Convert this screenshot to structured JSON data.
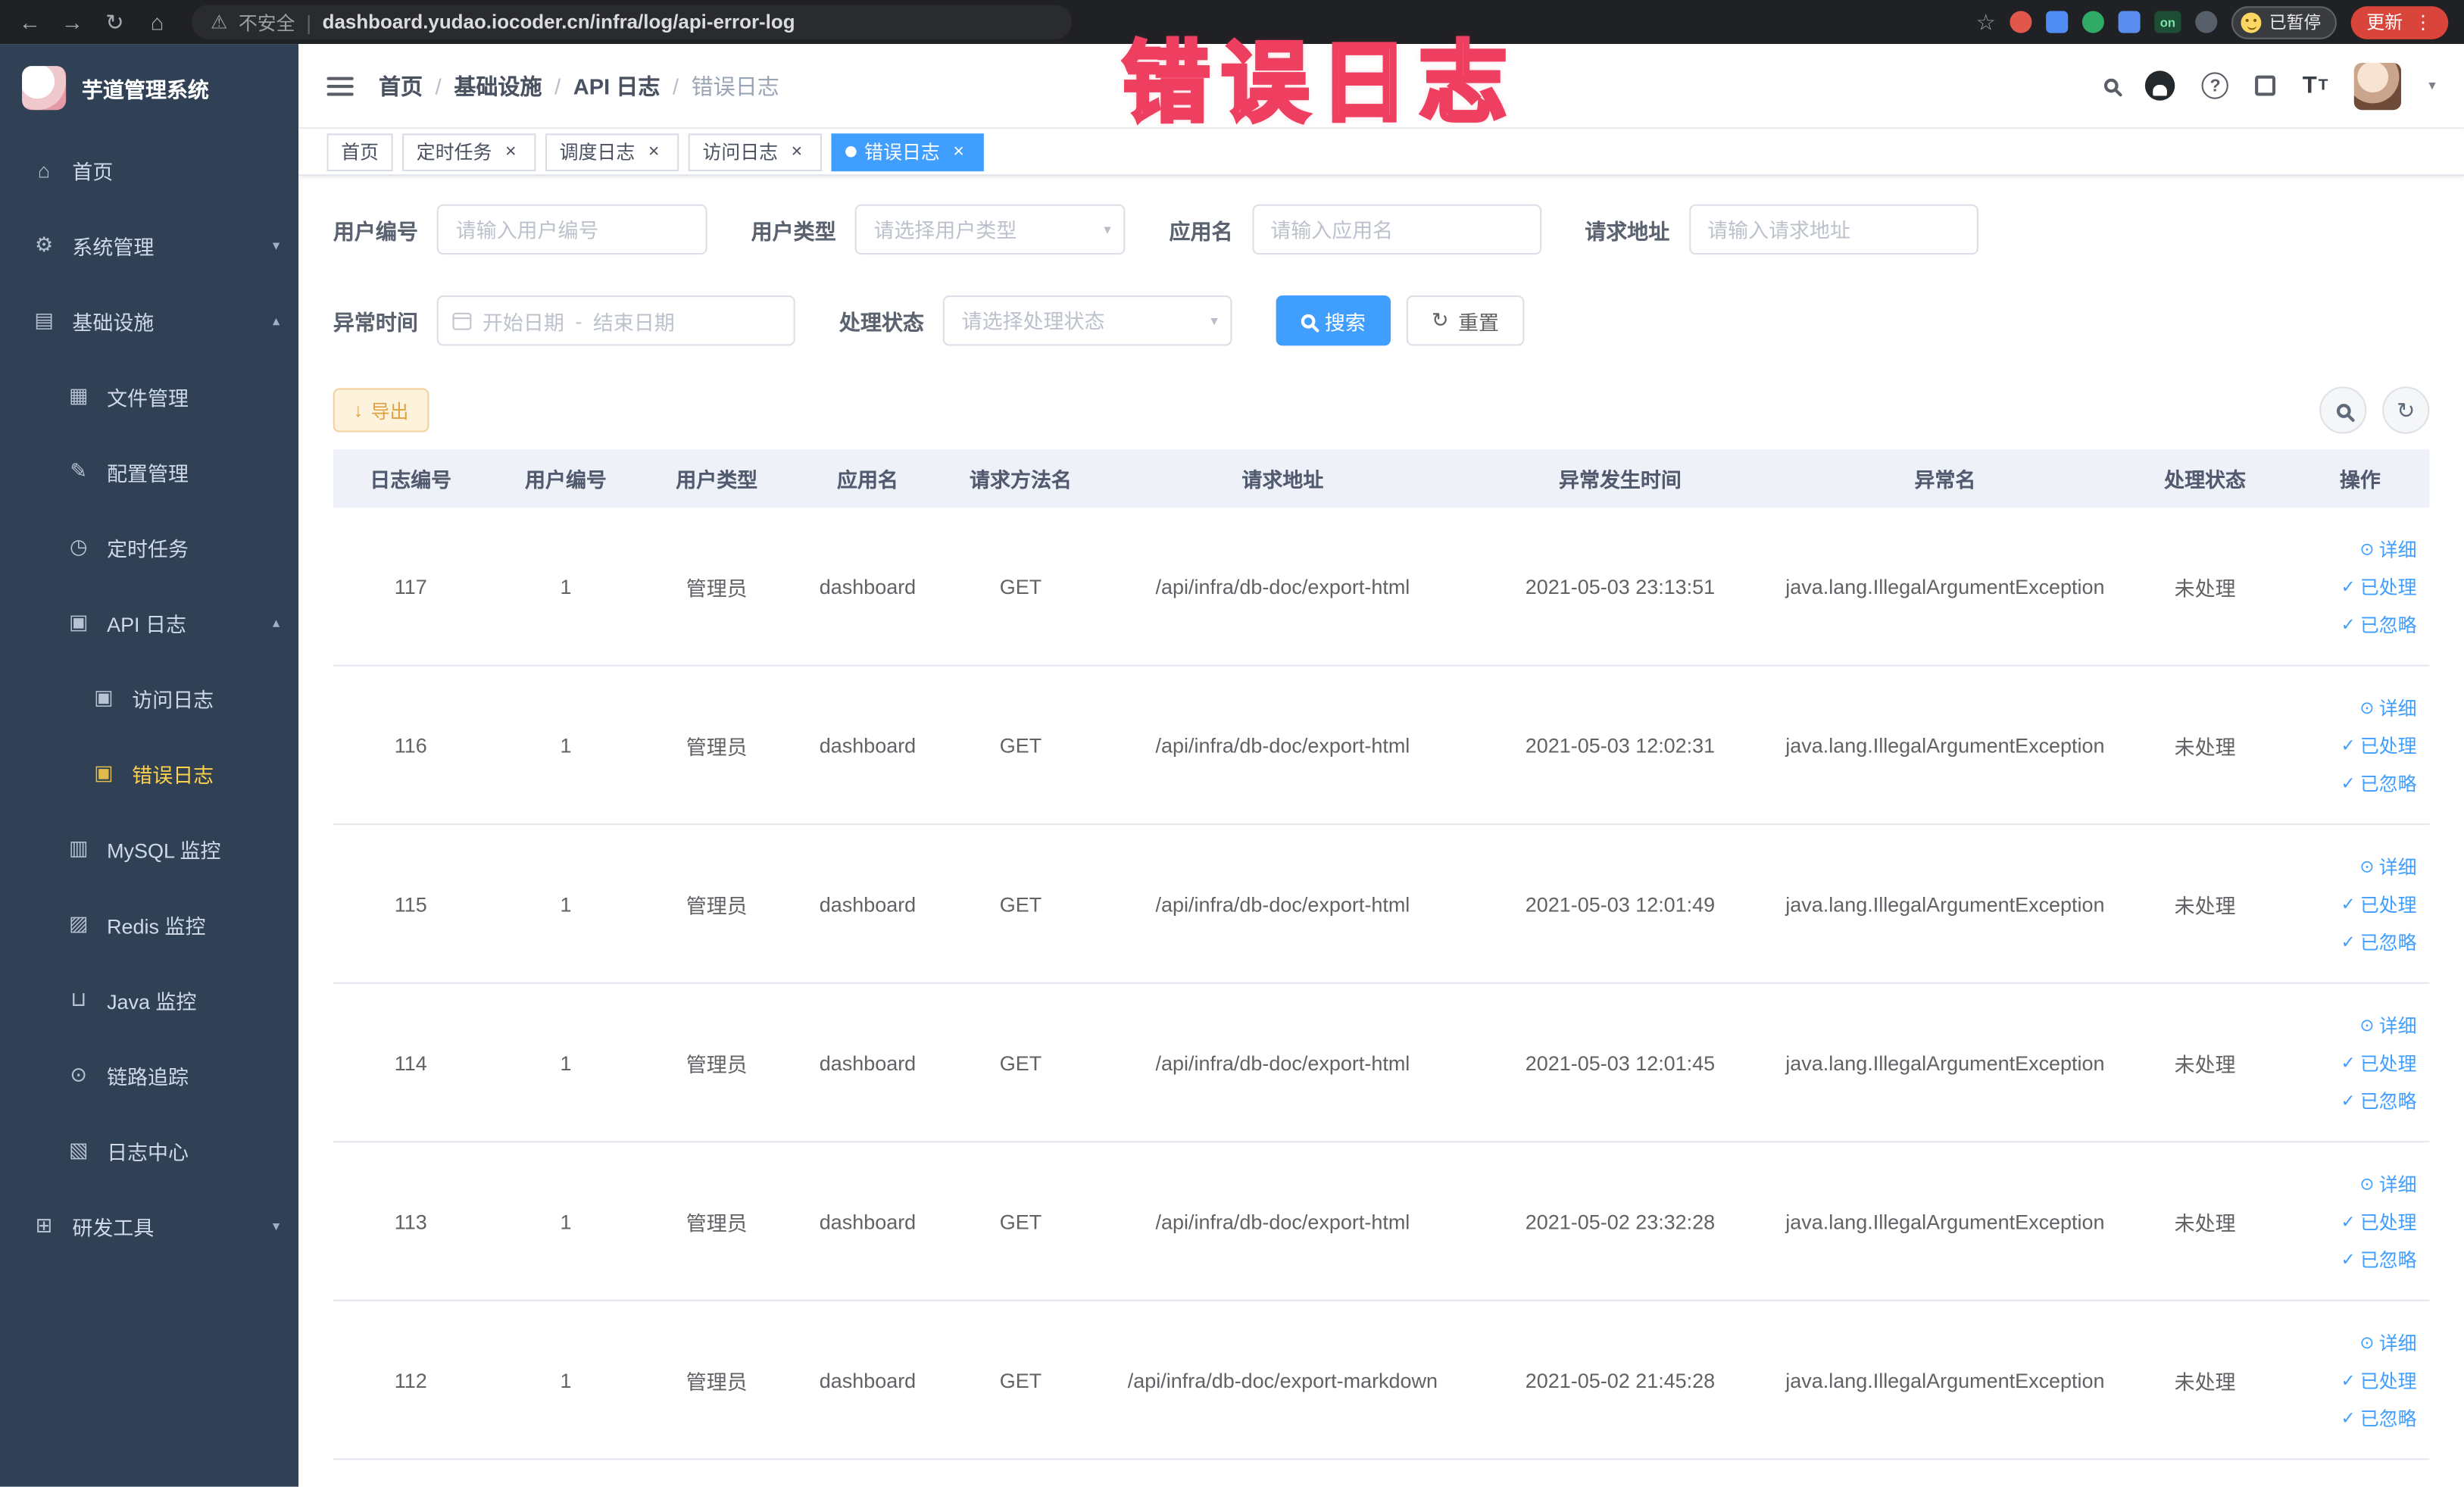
{
  "browser": {
    "security_label": "不安全",
    "url": "dashboard.yudao.iocoder.cn/infra/log/api-error-log",
    "profile_label": "已暂停",
    "update_label": "更新",
    "ext_on": "on"
  },
  "icons": {
    "back": "←",
    "forward": "→",
    "reload": "↻",
    "home": "⌂",
    "warning": "⚠",
    "divider": "|",
    "star": "☆",
    "kebab": "⋮",
    "help": "?",
    "caret": "▾",
    "t_big": "T",
    "t_small": "T",
    "refresh": "↻",
    "download": "↓",
    "select_caret": "▾"
  },
  "overlay": {
    "title": "错误日志"
  },
  "sidebar": {
    "logo_title": "芋道管理系统",
    "menu": [
      {
        "name": "sidebar-item-home",
        "icon": "home-icon",
        "glyph": "⌂",
        "label": "首页",
        "level": 1,
        "active": false,
        "arrow": ""
      },
      {
        "name": "sidebar-item-system",
        "icon": "gear-icon",
        "glyph": "⚙",
        "label": "系统管理",
        "level": 1,
        "active": false,
        "arrow": "▾"
      },
      {
        "name": "sidebar-item-infra",
        "icon": "grid-icon",
        "glyph": "▤",
        "label": "基础设施",
        "level": 1,
        "active": false,
        "arrow": "▴"
      },
      {
        "name": "sidebar-item-file",
        "icon": "folder-icon",
        "glyph": "▦",
        "label": "文件管理",
        "level": 2,
        "active": false,
        "arrow": ""
      },
      {
        "name": "sidebar-item-config",
        "icon": "edit-icon",
        "glyph": "✎",
        "label": "配置管理",
        "level": 2,
        "active": false,
        "arrow": ""
      },
      {
        "name": "sidebar-item-job",
        "icon": "clock-icon",
        "glyph": "◷",
        "label": "定时任务",
        "level": 2,
        "active": false,
        "arrow": ""
      },
      {
        "name": "sidebar-item-api-log",
        "icon": "log-icon",
        "glyph": "▣",
        "label": "API 日志",
        "level": 2,
        "active": false,
        "arrow": "▴"
      },
      {
        "name": "sidebar-item-access-log",
        "icon": "document-icon",
        "glyph": "▣",
        "label": "访问日志",
        "level": 3,
        "active": false,
        "arrow": ""
      },
      {
        "name": "sidebar-item-error-log",
        "icon": "document-icon",
        "glyph": "▣",
        "label": "错误日志",
        "level": 3,
        "active": true,
        "arrow": ""
      },
      {
        "name": "sidebar-item-mysql",
        "icon": "database-icon",
        "glyph": "▥",
        "label": "MySQL 监控",
        "level": 2,
        "active": false,
        "arrow": ""
      },
      {
        "name": "sidebar-item-redis",
        "icon": "layers-icon",
        "glyph": "▨",
        "label": "Redis 监控",
        "level": 2,
        "active": false,
        "arrow": ""
      },
      {
        "name": "sidebar-item-java",
        "icon": "coffee-icon",
        "glyph": "⊔",
        "label": "Java 监控",
        "level": 2,
        "active": false,
        "arrow": ""
      },
      {
        "name": "sidebar-item-trace",
        "icon": "eye-icon",
        "glyph": "⊙",
        "label": "链路追踪",
        "level": 2,
        "active": false,
        "arrow": ""
      },
      {
        "name": "sidebar-item-log-center",
        "icon": "document-icon",
        "glyph": "▧",
        "label": "日志中心",
        "level": 2,
        "active": false,
        "arrow": ""
      },
      {
        "name": "sidebar-item-devtools",
        "icon": "tools-icon",
        "glyph": "⊞",
        "label": "研发工具",
        "level": 1,
        "active": false,
        "arrow": "▾"
      }
    ]
  },
  "header": {
    "breadcrumbs": [
      {
        "name": "breadcrumb-home",
        "label": "首页",
        "sep": "/"
      },
      {
        "name": "breadcrumb-infra",
        "label": "基础设施",
        "sep": "/"
      },
      {
        "name": "breadcrumb-api-log",
        "label": "API 日志",
        "sep": "/"
      },
      {
        "name": "breadcrumb-error-log",
        "label": "错误日志",
        "sep": ""
      }
    ]
  },
  "tags": [
    {
      "name": "tab-home",
      "label": "首页",
      "close": "",
      "active": false
    },
    {
      "name": "tab-job",
      "label": "定时任务",
      "close": "×",
      "active": false
    },
    {
      "name": "tab-schedule-log",
      "label": "调度日志",
      "close": "×",
      "active": false
    },
    {
      "name": "tab-access-log",
      "label": "访问日志",
      "close": "×",
      "active": false
    },
    {
      "name": "tab-error-log",
      "label": "错误日志",
      "close": "×",
      "active": true
    }
  ],
  "filters": {
    "user_id": {
      "label": "用户编号",
      "placeholder": "请输入用户编号"
    },
    "user_type": {
      "label": "用户类型",
      "placeholder": "请选择用户类型"
    },
    "app_name": {
      "label": "应用名",
      "placeholder": "请输入应用名"
    },
    "request_url": {
      "label": "请求地址",
      "placeholder": "请输入请求地址"
    },
    "exception_time": {
      "label": "异常时间",
      "start_placeholder": "开始日期",
      "range_separator": "-",
      "end_placeholder": "结束日期"
    },
    "process_status": {
      "label": "处理状态",
      "placeholder": "请选择处理状态"
    },
    "search_button": "搜索",
    "reset_button": "重置"
  },
  "toolbar": {
    "export_label": "导出"
  },
  "table": {
    "columns": [
      "日志编号",
      "用户编号",
      "用户类型",
      "应用名",
      "请求方法名",
      "请求地址",
      "异常发生时间",
      "异常名",
      "处理状态",
      "操作"
    ],
    "actions": [
      {
        "name": "action-detail-link",
        "icon": "eye-icon",
        "glyph": "⊙",
        "label": "详细"
      },
      {
        "name": "action-processed-link",
        "icon": "check-icon",
        "glyph": "✓",
        "label": "已处理"
      },
      {
        "name": "action-ignored-link",
        "icon": "check-icon",
        "glyph": "✓",
        "label": "已忽略"
      }
    ],
    "rows": [
      {
        "id": "117",
        "user_id": "1",
        "user_type": "管理员",
        "app": "dashboard",
        "method": "GET",
        "url": "/api/infra/db-doc/export-html",
        "time": "2021-05-03 23:13:51",
        "exception": "java.lang.IllegalArgumentException",
        "status": "未处理"
      },
      {
        "id": "116",
        "user_id": "1",
        "user_type": "管理员",
        "app": "dashboard",
        "method": "GET",
        "url": "/api/infra/db-doc/export-html",
        "time": "2021-05-03 12:02:31",
        "exception": "java.lang.IllegalArgumentException",
        "status": "未处理"
      },
      {
        "id": "115",
        "user_id": "1",
        "user_type": "管理员",
        "app": "dashboard",
        "method": "GET",
        "url": "/api/infra/db-doc/export-html",
        "time": "2021-05-03 12:01:49",
        "exception": "java.lang.IllegalArgumentException",
        "status": "未处理"
      },
      {
        "id": "114",
        "user_id": "1",
        "user_type": "管理员",
        "app": "dashboard",
        "method": "GET",
        "url": "/api/infra/db-doc/export-html",
        "time": "2021-05-03 12:01:45",
        "exception": "java.lang.IllegalArgumentException",
        "status": "未处理"
      },
      {
        "id": "113",
        "user_id": "1",
        "user_type": "管理员",
        "app": "dashboard",
        "method": "GET",
        "url": "/api/infra/db-doc/export-html",
        "time": "2021-05-02 23:32:28",
        "exception": "java.lang.IllegalArgumentException",
        "status": "未处理"
      },
      {
        "id": "112",
        "user_id": "1",
        "user_type": "管理员",
        "app": "dashboard",
        "method": "GET",
        "url": "/api/infra/db-doc/export-markdown",
        "time": "2021-05-02 21:45:28",
        "exception": "java.lang.IllegalArgumentException",
        "status": "未处理"
      }
    ]
  }
}
